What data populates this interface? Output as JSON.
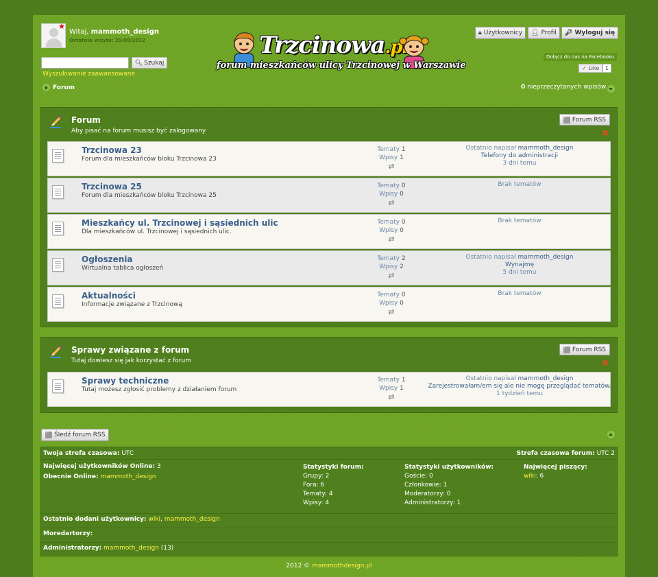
{
  "header": {
    "greeting": "Witaj,",
    "username": "mammoth_design",
    "last_visit": "Ostatnia wizyta: 29/08/2012",
    "search_placeholder": "",
    "search_button": "Szukaj",
    "advanced_search": "Wyszukiwanie zaawansowane",
    "breadcrumb": "Forum",
    "logo_title_main": "Trzcinowa",
    "logo_title_ext": ".pl",
    "logo_tagline": "forum mieszkańców ulicy Trzcinowej  w Warszawie",
    "top_buttons": [
      "Użytkownicy",
      "Profil",
      "Wyloguj się"
    ],
    "facebook_join": "Dołącz do nas na Facebooku",
    "like_label": "Like",
    "like_count": "1",
    "unread_count": "0",
    "unread_label": "nieprzeczytanych wpisów"
  },
  "categories": [
    {
      "title": "Forum",
      "description": "Aby pisać na forum musisz być zalogowany",
      "rss_label": "Forum RSS",
      "forums": [
        {
          "title": "Trzcinowa 23",
          "description": "Forum dla mieszkańców bloku Trzcinowa 23",
          "topics_label": "Tematy",
          "topics": "1",
          "posts_label": "Wpisy",
          "posts": "1",
          "last_prefix": "Ostatnio napisał",
          "last_user": "mammoth_design",
          "last_topic": "Telefony do administracji",
          "last_time": "3 dni temu",
          "no_topics": ""
        },
        {
          "title": "Trzcinowa 25",
          "description": "Forum dla mieszkańców bloku Trzcinowa 25",
          "topics_label": "Tematy",
          "topics": "0",
          "posts_label": "Wpisy",
          "posts": "0",
          "last_prefix": "",
          "last_user": "",
          "last_topic": "",
          "last_time": "",
          "no_topics": "Brak tematów"
        },
        {
          "title": "Mieszkańcy ul. Trzcinowej i sąsiednich ulic",
          "description": "Dla mieszkańców ul. Trzcinowej i sąsiednich ulic.",
          "topics_label": "Tematy",
          "topics": "0",
          "posts_label": "Wpisy",
          "posts": "0",
          "last_prefix": "",
          "last_user": "",
          "last_topic": "",
          "last_time": "",
          "no_topics": "Brak tematów"
        },
        {
          "title": "Ogłoszenia",
          "description": "Wirtualna tablica ogłoszeń",
          "topics_label": "Tematy",
          "topics": "2",
          "posts_label": "Wpisy",
          "posts": "2",
          "last_prefix": "Ostatnio napisał",
          "last_user": "mammoth_design",
          "last_topic": "Wynajmę",
          "last_time": "5 dni temu",
          "no_topics": ""
        },
        {
          "title": "Aktualności",
          "description": "Informacje związane z Trzcinową",
          "topics_label": "Tematy",
          "topics": "0",
          "posts_label": "Wpisy",
          "posts": "0",
          "last_prefix": "",
          "last_user": "",
          "last_topic": "",
          "last_time": "",
          "no_topics": "Brak tematów"
        }
      ]
    },
    {
      "title": "Sprawy związane z forum",
      "description": "Tutaj dowiesz się jak korzystać z forum",
      "rss_label": "Forum RSS",
      "forums": [
        {
          "title": "Sprawy techniczne",
          "description": "Tutaj możesz zgłosić problemy z działaniem forum",
          "topics_label": "Tematy",
          "topics": "1",
          "posts_label": "Wpisy",
          "posts": "1",
          "last_prefix": "Ostatnio napisał",
          "last_user": "mammoth_design",
          "last_topic": "Zarejestrowałam/em się ale nie mogę przeglądać tematów.",
          "last_time": "1 tydzień temu",
          "no_topics": ""
        }
      ]
    }
  ],
  "footer": {
    "follow_rss": "Śledź forum RSS",
    "timezone_label": "Twoja strefa czasowa:",
    "timezone_value": "UTC",
    "forum_timezone_label": "Strefa czasowa forum:",
    "forum_timezone_value": "UTC 2",
    "max_online_label": "Najwięcej użytkowników Online:",
    "max_online_value": "3",
    "now_online_label": "Obecnie Online:",
    "now_online_user": "mammoth_design",
    "forum_stats_title": "Statystyki forum:",
    "forum_stats": [
      "Grupy: 2",
      "Fora: 6",
      "Tematy: 4",
      "Wpisy: 4"
    ],
    "user_stats_title": "Statystyki użytkowników:",
    "user_stats": [
      "Goście: 0",
      "Członkowie: 1",
      "Moderatorzy: 0",
      "Administratorzy: 1"
    ],
    "top_poster_title": "Najwięcej piszący:",
    "top_poster_user": "wiki",
    "top_poster_count": ": 6",
    "recent_users_label": "Ostatnio dodani użytkownicy:",
    "recent_users": [
      "wiki",
      "mammoth_design"
    ],
    "moderators_label": "Moredartorzy:",
    "admins_label": "Administratorzy:",
    "admin_user": "mammoth_design",
    "admin_count": "(13)",
    "copyright_text": "2012 ©",
    "copyright_link": "mammothdesign.pl"
  }
}
